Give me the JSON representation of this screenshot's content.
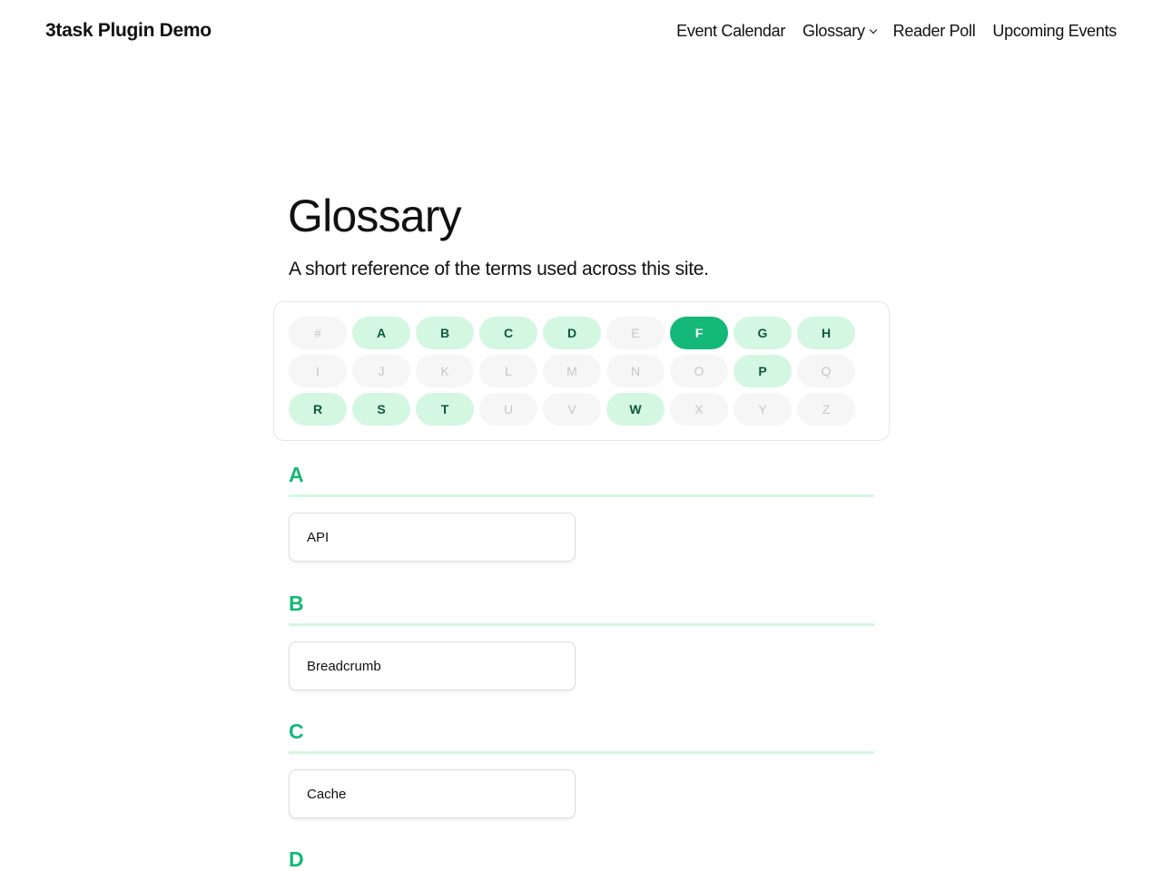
{
  "site": {
    "title": "3task Plugin Demo"
  },
  "nav": {
    "items": [
      {
        "label": "Event Calendar"
      },
      {
        "label": "Glossary"
      },
      {
        "label": "Reader Poll"
      },
      {
        "label": "Upcoming Events"
      }
    ]
  },
  "page": {
    "title": "Glossary",
    "subtitle": "A short reference of the terms used across this site."
  },
  "az": {
    "active_letter": "F",
    "letters": [
      {
        "char": "#",
        "state": "off"
      },
      {
        "char": "A",
        "state": "on"
      },
      {
        "char": "B",
        "state": "on"
      },
      {
        "char": "C",
        "state": "on"
      },
      {
        "char": "D",
        "state": "on"
      },
      {
        "char": "E",
        "state": "off"
      },
      {
        "char": "F",
        "state": "active"
      },
      {
        "char": "G",
        "state": "on"
      },
      {
        "char": "H",
        "state": "on"
      },
      {
        "char": "I",
        "state": "off"
      },
      {
        "char": "J",
        "state": "off"
      },
      {
        "char": "K",
        "state": "off"
      },
      {
        "char": "L",
        "state": "off"
      },
      {
        "char": "M",
        "state": "off"
      },
      {
        "char": "N",
        "state": "off"
      },
      {
        "char": "O",
        "state": "off"
      },
      {
        "char": "P",
        "state": "on"
      },
      {
        "char": "Q",
        "state": "off"
      },
      {
        "char": "R",
        "state": "on"
      },
      {
        "char": "S",
        "state": "on"
      },
      {
        "char": "T",
        "state": "on"
      },
      {
        "char": "U",
        "state": "off"
      },
      {
        "char": "V",
        "state": "off"
      },
      {
        "char": "W",
        "state": "on"
      },
      {
        "char": "X",
        "state": "off"
      },
      {
        "char": "Y",
        "state": "off"
      },
      {
        "char": "Z",
        "state": "off"
      }
    ]
  },
  "sections": [
    {
      "letter": "A",
      "terms": [
        "API"
      ]
    },
    {
      "letter": "B",
      "terms": [
        "Breadcrumb"
      ]
    },
    {
      "letter": "C",
      "terms": [
        "Cache"
      ]
    },
    {
      "letter": "D",
      "terms": []
    }
  ],
  "colors": {
    "accent": "#14b877",
    "letter_on_bg": "#d4f7e2",
    "letter_on_text": "#0b5a3a",
    "letter_off_bg": "#f6f6f6",
    "letter_off_text": "#c7c7c7"
  }
}
